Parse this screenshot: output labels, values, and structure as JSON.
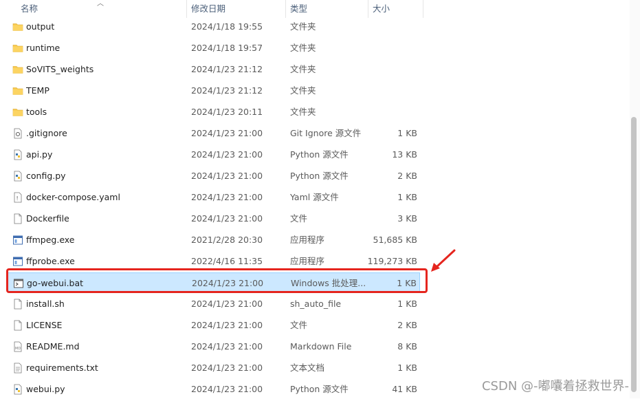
{
  "columns": {
    "name": "名称",
    "date": "修改日期",
    "type": "类型",
    "size": "大小"
  },
  "files": [
    {
      "name": "output",
      "date": "2024/1/18 19:55",
      "type": "文件夹",
      "size": "",
      "icon": "folder-icon"
    },
    {
      "name": "runtime",
      "date": "2024/1/18 19:57",
      "type": "文件夹",
      "size": "",
      "icon": "folder-icon"
    },
    {
      "name": "SoVITS_weights",
      "date": "2024/1/23 21:12",
      "type": "文件夹",
      "size": "",
      "icon": "folder-icon"
    },
    {
      "name": "TEMP",
      "date": "2024/1/23 21:12",
      "type": "文件夹",
      "size": "",
      "icon": "folder-icon"
    },
    {
      "name": "tools",
      "date": "2024/1/23 20:11",
      "type": "文件夹",
      "size": "",
      "icon": "folder-icon"
    },
    {
      "name": ".gitignore",
      "date": "2024/1/23 21:00",
      "type": "Git Ignore 源文件",
      "size": "1 KB",
      "icon": "gitignore-file-icon"
    },
    {
      "name": "api.py",
      "date": "2024/1/23 21:00",
      "type": "Python 源文件",
      "size": "13 KB",
      "icon": "python-file-icon"
    },
    {
      "name": "config.py",
      "date": "2024/1/23 21:00",
      "type": "Python 源文件",
      "size": "2 KB",
      "icon": "python-file-icon"
    },
    {
      "name": "docker-compose.yaml",
      "date": "2024/1/23 21:00",
      "type": "Yaml 源文件",
      "size": "1 KB",
      "icon": "yaml-file-icon"
    },
    {
      "name": "Dockerfile",
      "date": "2024/1/23 21:00",
      "type": "文件",
      "size": "3 KB",
      "icon": "blank-file-icon"
    },
    {
      "name": "ffmpeg.exe",
      "date": "2021/2/28 20:30",
      "type": "应用程序",
      "size": "51,685 KB",
      "icon": "exe-file-icon"
    },
    {
      "name": "ffprobe.exe",
      "date": "2022/4/16 11:35",
      "type": "应用程序",
      "size": "119,273 KB",
      "icon": "exe-file-icon"
    },
    {
      "name": "go-webui.bat",
      "date": "2024/1/23 21:00",
      "type": "Windows 批处理...",
      "size": "1 KB",
      "icon": "bat-file-icon",
      "selected": true
    },
    {
      "name": "install.sh",
      "date": "2024/1/23 21:00",
      "type": "sh_auto_file",
      "size": "1 KB",
      "icon": "blank-file-icon"
    },
    {
      "name": "LICENSE",
      "date": "2024/1/23 21:00",
      "type": "文件",
      "size": "2 KB",
      "icon": "blank-file-icon"
    },
    {
      "name": "README.md",
      "date": "2024/1/23 21:00",
      "type": "Markdown File",
      "size": "8 KB",
      "icon": "markdown-file-icon"
    },
    {
      "name": "requirements.txt",
      "date": "2024/1/23 21:00",
      "type": "文本文档",
      "size": "1 KB",
      "icon": "text-file-icon"
    },
    {
      "name": "webui.py",
      "date": "2024/1/23 21:00",
      "type": "Python 源文件",
      "size": "41 KB",
      "icon": "python-file-icon"
    }
  ],
  "watermark": "CSDN @-嘟囔着拯救世界-",
  "colors": {
    "selection": "#cce8ff",
    "highlight_box": "#e5251e",
    "folder": "#f8c74a"
  }
}
